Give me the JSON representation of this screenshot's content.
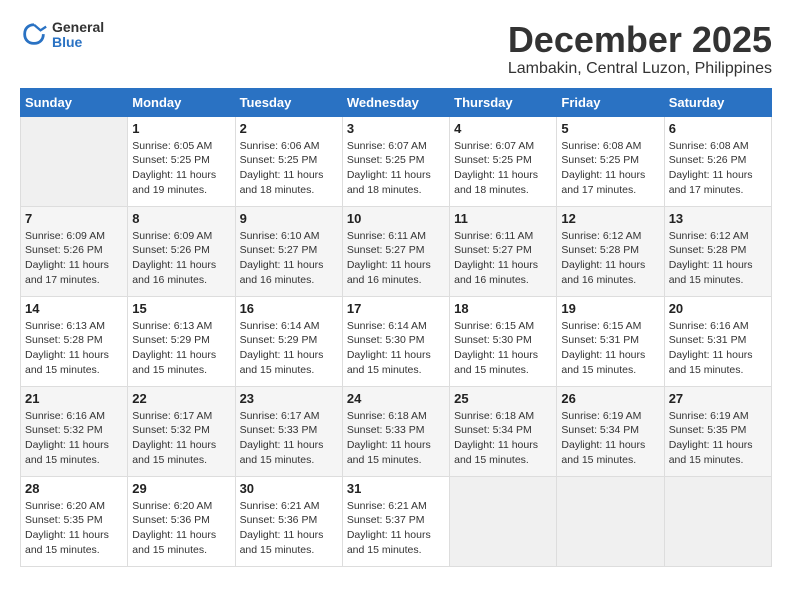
{
  "header": {
    "logo_general": "General",
    "logo_blue": "Blue",
    "month_title": "December 2025",
    "location": "Lambakin, Central Luzon, Philippines"
  },
  "weekdays": [
    "Sunday",
    "Monday",
    "Tuesday",
    "Wednesday",
    "Thursday",
    "Friday",
    "Saturday"
  ],
  "weeks": [
    [
      {
        "day": "",
        "sunrise": "",
        "sunset": "",
        "daylight": ""
      },
      {
        "day": "1",
        "sunrise": "Sunrise: 6:05 AM",
        "sunset": "Sunset: 5:25 PM",
        "daylight": "Daylight: 11 hours and 19 minutes."
      },
      {
        "day": "2",
        "sunrise": "Sunrise: 6:06 AM",
        "sunset": "Sunset: 5:25 PM",
        "daylight": "Daylight: 11 hours and 18 minutes."
      },
      {
        "day": "3",
        "sunrise": "Sunrise: 6:07 AM",
        "sunset": "Sunset: 5:25 PM",
        "daylight": "Daylight: 11 hours and 18 minutes."
      },
      {
        "day": "4",
        "sunrise": "Sunrise: 6:07 AM",
        "sunset": "Sunset: 5:25 PM",
        "daylight": "Daylight: 11 hours and 18 minutes."
      },
      {
        "day": "5",
        "sunrise": "Sunrise: 6:08 AM",
        "sunset": "Sunset: 5:25 PM",
        "daylight": "Daylight: 11 hours and 17 minutes."
      },
      {
        "day": "6",
        "sunrise": "Sunrise: 6:08 AM",
        "sunset": "Sunset: 5:26 PM",
        "daylight": "Daylight: 11 hours and 17 minutes."
      }
    ],
    [
      {
        "day": "7",
        "sunrise": "Sunrise: 6:09 AM",
        "sunset": "Sunset: 5:26 PM",
        "daylight": "Daylight: 11 hours and 17 minutes."
      },
      {
        "day": "8",
        "sunrise": "Sunrise: 6:09 AM",
        "sunset": "Sunset: 5:26 PM",
        "daylight": "Daylight: 11 hours and 16 minutes."
      },
      {
        "day": "9",
        "sunrise": "Sunrise: 6:10 AM",
        "sunset": "Sunset: 5:27 PM",
        "daylight": "Daylight: 11 hours and 16 minutes."
      },
      {
        "day": "10",
        "sunrise": "Sunrise: 6:11 AM",
        "sunset": "Sunset: 5:27 PM",
        "daylight": "Daylight: 11 hours and 16 minutes."
      },
      {
        "day": "11",
        "sunrise": "Sunrise: 6:11 AM",
        "sunset": "Sunset: 5:27 PM",
        "daylight": "Daylight: 11 hours and 16 minutes."
      },
      {
        "day": "12",
        "sunrise": "Sunrise: 6:12 AM",
        "sunset": "Sunset: 5:28 PM",
        "daylight": "Daylight: 11 hours and 16 minutes."
      },
      {
        "day": "13",
        "sunrise": "Sunrise: 6:12 AM",
        "sunset": "Sunset: 5:28 PM",
        "daylight": "Daylight: 11 hours and 15 minutes."
      }
    ],
    [
      {
        "day": "14",
        "sunrise": "Sunrise: 6:13 AM",
        "sunset": "Sunset: 5:28 PM",
        "daylight": "Daylight: 11 hours and 15 minutes."
      },
      {
        "day": "15",
        "sunrise": "Sunrise: 6:13 AM",
        "sunset": "Sunset: 5:29 PM",
        "daylight": "Daylight: 11 hours and 15 minutes."
      },
      {
        "day": "16",
        "sunrise": "Sunrise: 6:14 AM",
        "sunset": "Sunset: 5:29 PM",
        "daylight": "Daylight: 11 hours and 15 minutes."
      },
      {
        "day": "17",
        "sunrise": "Sunrise: 6:14 AM",
        "sunset": "Sunset: 5:30 PM",
        "daylight": "Daylight: 11 hours and 15 minutes."
      },
      {
        "day": "18",
        "sunrise": "Sunrise: 6:15 AM",
        "sunset": "Sunset: 5:30 PM",
        "daylight": "Daylight: 11 hours and 15 minutes."
      },
      {
        "day": "19",
        "sunrise": "Sunrise: 6:15 AM",
        "sunset": "Sunset: 5:31 PM",
        "daylight": "Daylight: 11 hours and 15 minutes."
      },
      {
        "day": "20",
        "sunrise": "Sunrise: 6:16 AM",
        "sunset": "Sunset: 5:31 PM",
        "daylight": "Daylight: 11 hours and 15 minutes."
      }
    ],
    [
      {
        "day": "21",
        "sunrise": "Sunrise: 6:16 AM",
        "sunset": "Sunset: 5:32 PM",
        "daylight": "Daylight: 11 hours and 15 minutes."
      },
      {
        "day": "22",
        "sunrise": "Sunrise: 6:17 AM",
        "sunset": "Sunset: 5:32 PM",
        "daylight": "Daylight: 11 hours and 15 minutes."
      },
      {
        "day": "23",
        "sunrise": "Sunrise: 6:17 AM",
        "sunset": "Sunset: 5:33 PM",
        "daylight": "Daylight: 11 hours and 15 minutes."
      },
      {
        "day": "24",
        "sunrise": "Sunrise: 6:18 AM",
        "sunset": "Sunset: 5:33 PM",
        "daylight": "Daylight: 11 hours and 15 minutes."
      },
      {
        "day": "25",
        "sunrise": "Sunrise: 6:18 AM",
        "sunset": "Sunset: 5:34 PM",
        "daylight": "Daylight: 11 hours and 15 minutes."
      },
      {
        "day": "26",
        "sunrise": "Sunrise: 6:19 AM",
        "sunset": "Sunset: 5:34 PM",
        "daylight": "Daylight: 11 hours and 15 minutes."
      },
      {
        "day": "27",
        "sunrise": "Sunrise: 6:19 AM",
        "sunset": "Sunset: 5:35 PM",
        "daylight": "Daylight: 11 hours and 15 minutes."
      }
    ],
    [
      {
        "day": "28",
        "sunrise": "Sunrise: 6:20 AM",
        "sunset": "Sunset: 5:35 PM",
        "daylight": "Daylight: 11 hours and 15 minutes."
      },
      {
        "day": "29",
        "sunrise": "Sunrise: 6:20 AM",
        "sunset": "Sunset: 5:36 PM",
        "daylight": "Daylight: 11 hours and 15 minutes."
      },
      {
        "day": "30",
        "sunrise": "Sunrise: 6:21 AM",
        "sunset": "Sunset: 5:36 PM",
        "daylight": "Daylight: 11 hours and 15 minutes."
      },
      {
        "day": "31",
        "sunrise": "Sunrise: 6:21 AM",
        "sunset": "Sunset: 5:37 PM",
        "daylight": "Daylight: 11 hours and 15 minutes."
      },
      {
        "day": "",
        "sunrise": "",
        "sunset": "",
        "daylight": ""
      },
      {
        "day": "",
        "sunrise": "",
        "sunset": "",
        "daylight": ""
      },
      {
        "day": "",
        "sunrise": "",
        "sunset": "",
        "daylight": ""
      }
    ]
  ]
}
